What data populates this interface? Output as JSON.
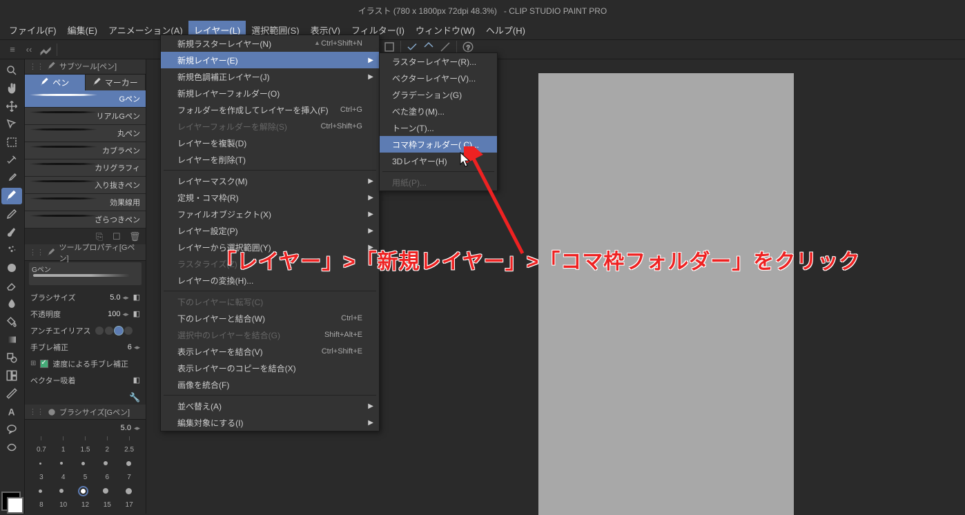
{
  "title": "イラスト (780 x 1800px 72dpi 48.3%)   - CLIP STUDIO PAINT PRO",
  "menubar": [
    {
      "label": "ファイル(F)"
    },
    {
      "label": "編集(E)"
    },
    {
      "label": "アニメーション(A)"
    },
    {
      "label": "レイヤー(L)",
      "active": true
    },
    {
      "label": "選択範囲(S)"
    },
    {
      "label": "表示(V)"
    },
    {
      "label": "フィルター(I)"
    },
    {
      "label": "ウィンドウ(W)"
    },
    {
      "label": "ヘルプ(H)"
    }
  ],
  "subtool_panel_title": "サブツール[ペン]",
  "subtool_tabs": [
    {
      "label": "ペン",
      "icon": "pen",
      "active": true
    },
    {
      "label": "マーカー",
      "icon": "marker"
    }
  ],
  "brushes": [
    {
      "name": "Gペン",
      "active": true
    },
    {
      "name": "リアルGペン"
    },
    {
      "name": "丸ペン"
    },
    {
      "name": "カブラペン"
    },
    {
      "name": "カリグラフィ"
    },
    {
      "name": "入り抜きペン"
    },
    {
      "name": "効果線用"
    },
    {
      "name": "ざらつきペン"
    }
  ],
  "tool_property_title": "ツールプロパティ[Gペン]",
  "brush_preview_label": "Gペン",
  "properties": {
    "brush_size": {
      "label": "ブラシサイズ",
      "value": "5.0"
    },
    "opacity": {
      "label": "不透明度",
      "value": "100"
    },
    "antialias": {
      "label": "アンチエイリアス"
    },
    "hand_correction": {
      "label": "手ブレ補正",
      "value": "6"
    },
    "speed_correction": {
      "label": "速度による手ブレ補正"
    },
    "vector_snap": {
      "label": "ベクター吸着"
    }
  },
  "brush_size_panel_title": "ブラシサイズ[Gペン]",
  "brush_size_value": "5.0",
  "size_presets_row1": [
    "0.7",
    "1",
    "1.5",
    "2",
    "2.5"
  ],
  "size_presets_row2": [
    "3",
    "4",
    "5",
    "6",
    "7"
  ],
  "size_presets_row3": [
    "8",
    "10",
    "12",
    "15",
    "17"
  ],
  "dropdown1": [
    {
      "label": "新規ラスターレイヤー(N)",
      "shortcut": "Ctrl+Shift+N",
      "type": "item"
    },
    {
      "label": "新規レイヤー(E)",
      "type": "item",
      "highlighted": true,
      "arrow": true
    },
    {
      "label": "新規色調補正レイヤー(J)",
      "type": "item",
      "arrow": true
    },
    {
      "label": "新規レイヤーフォルダー(O)",
      "type": "item"
    },
    {
      "label": "フォルダーを作成してレイヤーを挿入(F)",
      "shortcut": "Ctrl+G",
      "type": "item"
    },
    {
      "label": "レイヤーフォルダーを解除(S)",
      "shortcut": "Ctrl+Shift+G",
      "type": "item",
      "disabled": true
    },
    {
      "label": "レイヤーを複製(D)",
      "type": "item"
    },
    {
      "label": "レイヤーを削除(T)",
      "type": "item"
    },
    {
      "type": "sep"
    },
    {
      "label": "レイヤーマスク(M)",
      "type": "item",
      "arrow": true
    },
    {
      "label": "定規・コマ枠(R)",
      "type": "item",
      "arrow": true
    },
    {
      "label": "ファイルオブジェクト(X)",
      "type": "item",
      "arrow": true
    },
    {
      "label": "レイヤー設定(P)",
      "type": "item",
      "arrow": true
    },
    {
      "label": "レイヤーから選択範囲(Y)",
      "type": "item",
      "arrow": true
    },
    {
      "label": "ラスタライズ(Z)",
      "type": "item",
      "disabled": true
    },
    {
      "label": "レイヤーの変換(H)...",
      "type": "item"
    },
    {
      "type": "sep"
    },
    {
      "label": "下のレイヤーに転写(C)",
      "type": "item",
      "disabled": true
    },
    {
      "label": "下のレイヤーと結合(W)",
      "shortcut": "Ctrl+E",
      "type": "item"
    },
    {
      "label": "選択中のレイヤーを結合(G)",
      "shortcut": "Shift+Alt+E",
      "type": "item",
      "disabled": true
    },
    {
      "label": "表示レイヤーを結合(V)",
      "shortcut": "Ctrl+Shift+E",
      "type": "item"
    },
    {
      "label": "表示レイヤーのコピーを結合(X)",
      "type": "item"
    },
    {
      "label": "画像を統合(F)",
      "type": "item"
    },
    {
      "type": "sep"
    },
    {
      "label": "並べ替え(A)",
      "type": "item",
      "arrow": true
    },
    {
      "label": "編集対象にする(I)",
      "type": "item",
      "arrow": true
    }
  ],
  "submenu": [
    {
      "label": "ラスターレイヤー(R)..."
    },
    {
      "label": "ベクターレイヤー(V)..."
    },
    {
      "label": "グラデーション(G)"
    },
    {
      "label": "べた塗り(M)..."
    },
    {
      "label": "トーン(T)..."
    },
    {
      "label": "コマ枠フォルダー( C)...",
      "highlighted": true
    },
    {
      "label": "3Dレイヤー(H)"
    },
    {
      "type": "sep"
    },
    {
      "label": "用紙(P)...",
      "disabled": true
    }
  ],
  "annotation": "「レイヤー」>「新規レイヤー」>「コマ枠フォルダー」をクリック"
}
